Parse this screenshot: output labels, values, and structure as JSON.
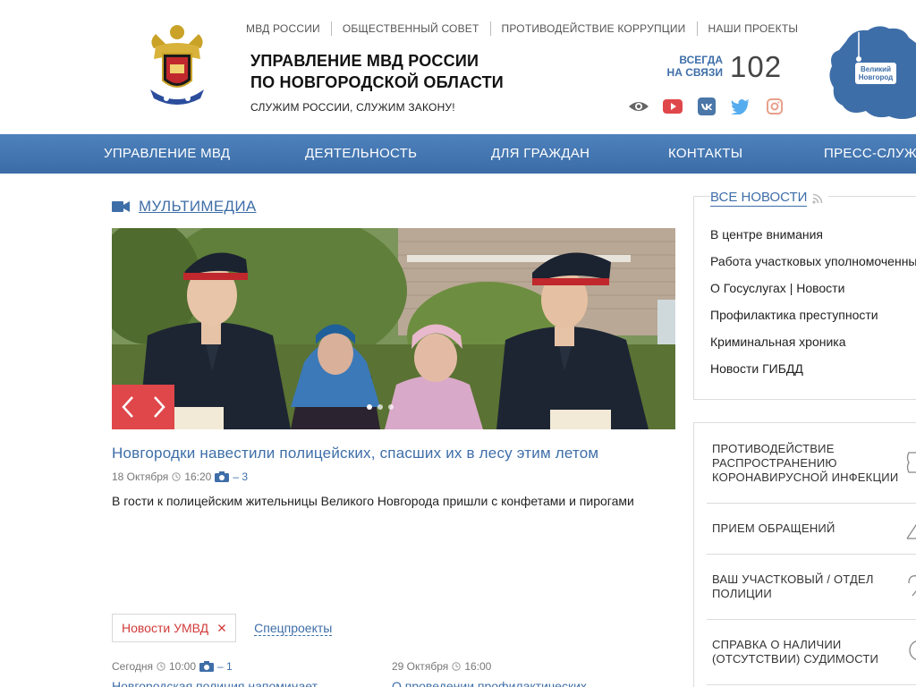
{
  "header": {
    "top_links": [
      "МВД РОССИИ",
      "ОБЩЕСТВЕННЫЙ СОВЕТ",
      "ПРОТИВОДЕЙСТВИЕ КОРРУПЦИИ",
      "НАШИ ПРОЕКТЫ"
    ],
    "title_line1": "УПРАВЛЕНИЕ МВД РОССИИ",
    "title_line2": "ПО НОВГОРОДСКОЙ ОБЛАСТИ",
    "motto": "СЛУЖИМ РОССИИ, СЛУЖИМ ЗАКОНУ!",
    "always_line1": "ВСЕГДА",
    "always_line2": "НА СВЯЗИ",
    "phone": "102",
    "map_label_line1": "Великий",
    "map_label_line2": "Новгород",
    "colors": {
      "accent": "#3e6ea8",
      "red": "#e0474a"
    }
  },
  "nav": {
    "items": [
      "УПРАВЛЕНИЕ МВД",
      "ДЕЯТЕЛЬНОСТЬ",
      "ДЛЯ ГРАЖДАН",
      "КОНТАКТЫ",
      "ПРЕСС-СЛУЖБА"
    ]
  },
  "multimedia": {
    "section_title": "МУЛЬТИМЕДИА",
    "story_title": "Новгородки навестили полицейских, спасших их в лесу этим летом",
    "story_date": "18 Октября",
    "story_time": "16:20",
    "story_photos": "– 3",
    "story_desc": "В гости к полицейским жительницы Великого Новгорода пришли с конфетами и пирогами"
  },
  "tabs": {
    "active": "Новости УМВД",
    "other": "Спецпроекты"
  },
  "news": [
    {
      "date": "Сегодня",
      "time": "10:00",
      "photos": "– 1",
      "title": "Новгородская полиция напоминает"
    },
    {
      "date": "29 Октября",
      "time": "16:00",
      "title": "О проведении профилактических"
    }
  ],
  "sidebar": {
    "all_news": "ВСЕ НОВОСТИ",
    "categories": [
      "В центре внимания",
      "Работа участковых уполномоченных",
      "О Госуслугах | Новости",
      "Профилактика преступности",
      "Криминальная хроника",
      "Новости ГИБДД"
    ],
    "services": [
      {
        "line1": "ПРОТИВОДЕЙСТВИЕ",
        "line2": "РАСПРОСТРАНЕНИЮ",
        "line3": "КОРОНАВИРУСНОЙ ИНФЕКЦИИ"
      },
      {
        "line1": "ПРИЕМ ОБРАЩЕНИЙ"
      },
      {
        "line1": "ВАШ УЧАСТКОВЫЙ / ОТДЕЛ",
        "line2": "ПОЛИЦИИ"
      },
      {
        "line1": "СПРАВКА О НАЛИЧИИ",
        "line2": "(ОТСУТСТВИИ) СУДИМОСТИ"
      }
    ]
  }
}
